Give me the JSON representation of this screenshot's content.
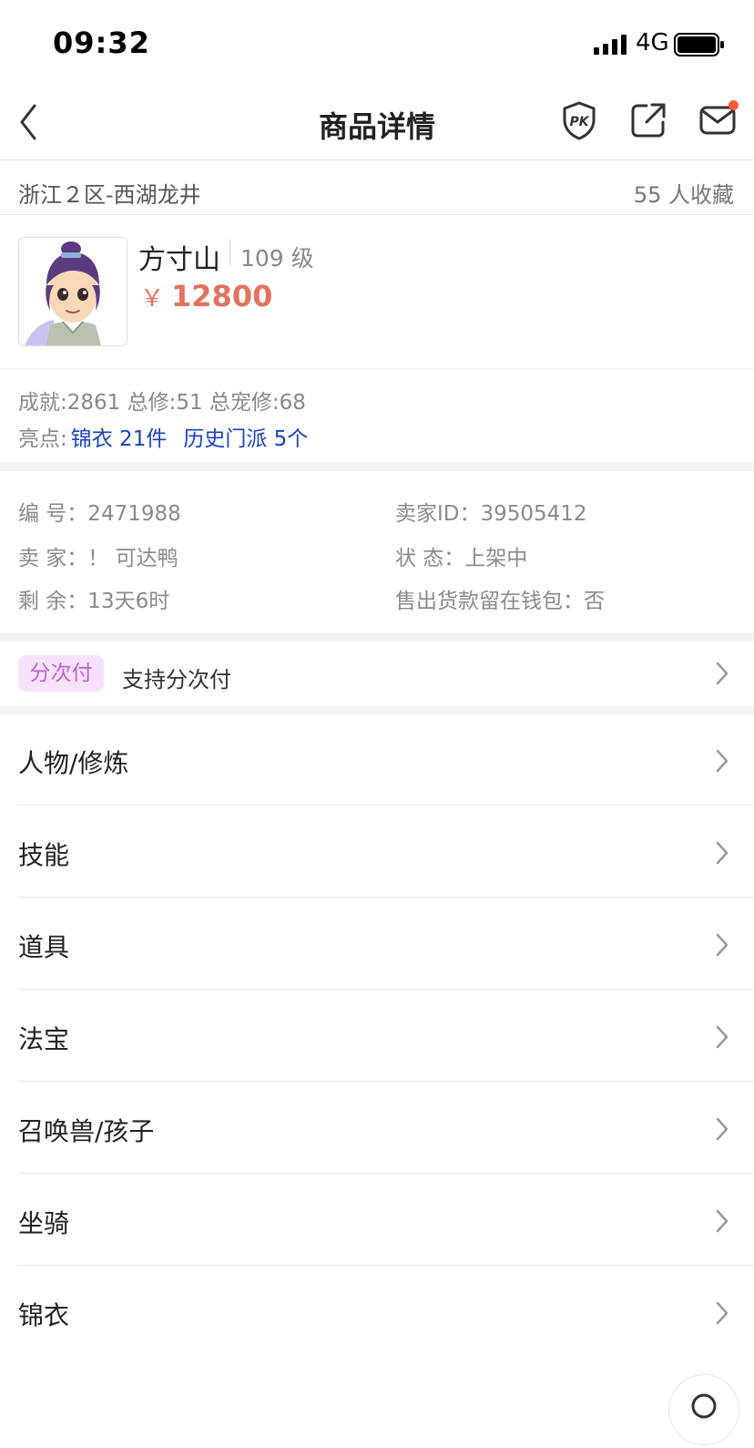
{
  "status_bar": {
    "time": "09:32",
    "network": "4G"
  },
  "nav": {
    "title": "商品详情"
  },
  "server": {
    "name": "浙江２区-西湖龙井",
    "favorites": "55 人收藏"
  },
  "product": {
    "school": "方寸山",
    "level": "109 级",
    "currency": "￥",
    "price": "12800"
  },
  "stats": {
    "line": "成就:2861 总修:51 总宠修:68",
    "highlights_label": "亮点:",
    "highlights": [
      "锦衣 21件",
      "历史门派 5个"
    ]
  },
  "info": {
    "id": "编 号：2471988",
    "seller_id": "卖家ID：39505412",
    "seller": "卖 家：！ 可达鸭",
    "status": "状 态：上架中",
    "remaining": "剩 余：13天6时",
    "wallet": "售出货款留在钱包：否"
  },
  "installment": {
    "badge": "分次付",
    "text": "支持分次付"
  },
  "menu": [
    {
      "label": "人物/修炼"
    },
    {
      "label": "技能"
    },
    {
      "label": "道具"
    },
    {
      "label": "法宝"
    },
    {
      "label": "召唤兽/孩子"
    },
    {
      "label": "坐骑"
    },
    {
      "label": "锦衣"
    }
  ],
  "icons": {
    "back": "chevron-left-icon",
    "pk": "pk-shield-icon",
    "share": "share-icon",
    "mail": "mail-icon",
    "search": "search-icon"
  },
  "colors": {
    "price": "#e0735f",
    "link": "#1a3fbf",
    "badge_bg": "#f6e3fb",
    "badge_text": "#c060d6",
    "notify_dot": "#ff5b3a"
  }
}
